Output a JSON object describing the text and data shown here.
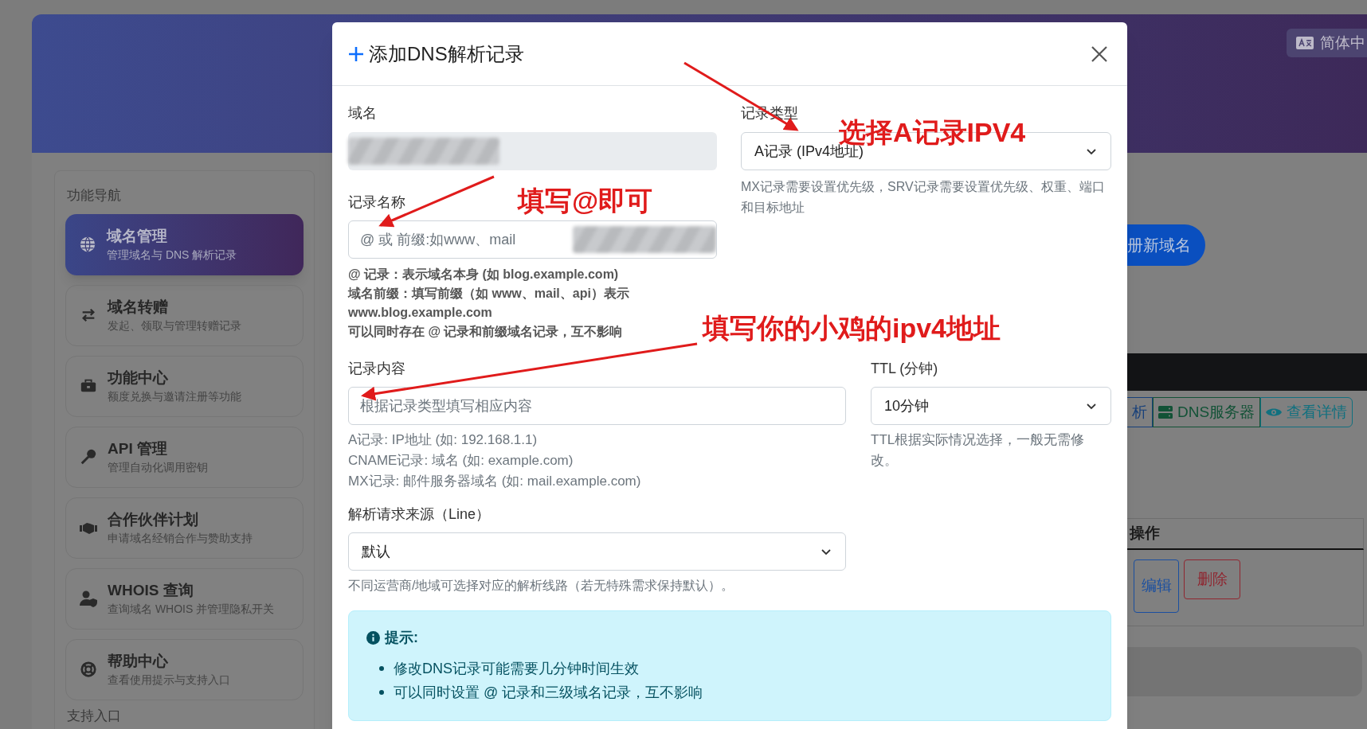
{
  "background": {
    "language_button": "简体中",
    "sidebar": {
      "heading": "功能导航",
      "items": [
        {
          "title": "域名管理",
          "subtitle": "管理域名与 DNS 解析记录",
          "selected": true
        },
        {
          "title": "域名转赠",
          "subtitle": "发起、领取与管理转赠记录",
          "selected": false
        },
        {
          "title": "功能中心",
          "subtitle": "额度兑换与邀请注册等功能",
          "selected": false
        },
        {
          "title": "API 管理",
          "subtitle": "管理自动化调用密钥",
          "selected": false
        },
        {
          "title": "合作伙伴计划",
          "subtitle": "申请域名经销合作与赞助支持",
          "selected": false
        },
        {
          "title": "WHOIS 查询",
          "subtitle": "查询域名 WHOIS 并管理隐私开关",
          "selected": false
        },
        {
          "title": "帮助中心",
          "subtitle": "查看使用提示与支持入口",
          "selected": false
        }
      ],
      "footer_heading": "支持入口"
    },
    "register_button": "册新域名",
    "action_buttons": [
      {
        "label": "析",
        "kind": "plain"
      },
      {
        "label": "DNS服务器",
        "kind": "server"
      },
      {
        "label": "查看详情",
        "kind": "view"
      }
    ],
    "table": {
      "header": "操作",
      "row_actions": [
        {
          "label": "编辑",
          "kind": "edit"
        },
        {
          "label": "删除",
          "kind": "delete"
        }
      ]
    }
  },
  "dialog": {
    "title": "添加DNS解析记录",
    "domain": {
      "label": "域名"
    },
    "record_type": {
      "label": "记录类型",
      "value": "A记录 (IPv4地址)",
      "help": "MX记录需要设置优先级，SRV记录需要设置优先级、权重、端口和目标地址"
    },
    "record_name": {
      "label": "记录名称",
      "placeholder": "@ 或 前缀:如www、mail",
      "help": [
        "@ 记录：表示域名本身 (如 blog.example.com)",
        "域名前缀：填写前缀（如 www、mail、api）表示 www.blog.example.com",
        "可以同时存在 @ 记录和前缀域名记录，互不影响"
      ]
    },
    "record_content": {
      "label": "记录内容",
      "placeholder": "根据记录类型填写相应内容",
      "help": [
        "A记录: IP地址 (如: 192.168.1.1)",
        "CNAME记录: 域名 (如: example.com)",
        "MX记录: 邮件服务器域名 (如: mail.example.com)"
      ]
    },
    "ttl": {
      "label": "TTL (分钟)",
      "value": "10分钟",
      "help": "TTL根据实际情况选择，一般无需修改。"
    },
    "line": {
      "label": "解析请求来源（Line）",
      "value": "默认",
      "help": "不同运营商/地域可选择对应的解析线路（若无特殊需求保持默认）。"
    },
    "tips": {
      "title": "提示:",
      "items": [
        "修改DNS记录可能需要几分钟时间生效",
        "可以同时设置 @ 记录和三级域名记录，互不影响"
      ]
    }
  },
  "annotations": [
    {
      "text": "选择A记录IPV4"
    },
    {
      "text": "填写@即可"
    },
    {
      "text": "填写你的小鸡的ipv4地址"
    }
  ]
}
